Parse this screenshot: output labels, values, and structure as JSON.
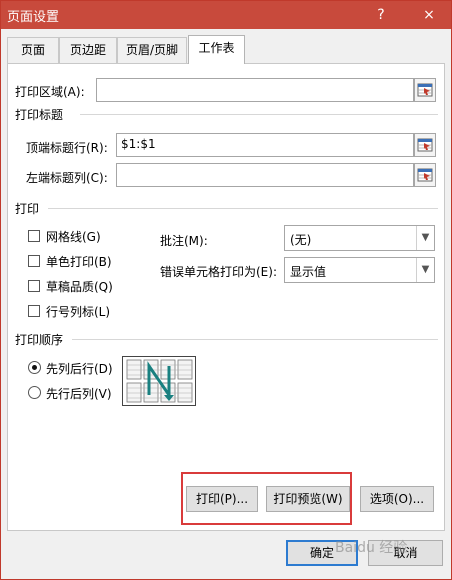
{
  "window": {
    "title": "页面设置",
    "help": "?",
    "close": "×"
  },
  "tabs": [
    {
      "label": "页面"
    },
    {
      "label": "页边距"
    },
    {
      "label": "页眉/页脚"
    },
    {
      "label": "工作表"
    }
  ],
  "print_area": {
    "label": "打印区域(A):",
    "value": ""
  },
  "print_titles": {
    "section": "打印标题",
    "rows_label": "顶端标题行(R):",
    "rows_value": "$1:$1",
    "cols_label": "左端标题列(C):",
    "cols_value": ""
  },
  "print": {
    "section": "打印",
    "gridlines": {
      "label": "网格线(G)",
      "checked": false
    },
    "black_white": {
      "label": "单色打印(B)",
      "checked": false
    },
    "draft": {
      "label": "草稿品质(Q)",
      "checked": false
    },
    "headings": {
      "label": "行号列标(L)",
      "checked": false
    },
    "comments_label": "批注(M):",
    "comments_value": "(无)",
    "errors_label": "错误单元格打印为(E):",
    "errors_value": "显示值"
  },
  "order": {
    "section": "打印顺序",
    "down_then_over": {
      "label": "先列后行(D)",
      "selected": true
    },
    "over_then_down": {
      "label": "先行后列(V)",
      "selected": false
    }
  },
  "buttons": {
    "print": "打印(P)...",
    "preview": "打印预览(W)",
    "options": "选项(O)...",
    "ok": "确定",
    "cancel": "取消"
  },
  "watermark": "Baidu 经验",
  "colors": {
    "titlebar": "#c84a3c",
    "highlight": "#d93b3b",
    "default_border": "#2d7bd0",
    "arrow": "#1a8080"
  }
}
